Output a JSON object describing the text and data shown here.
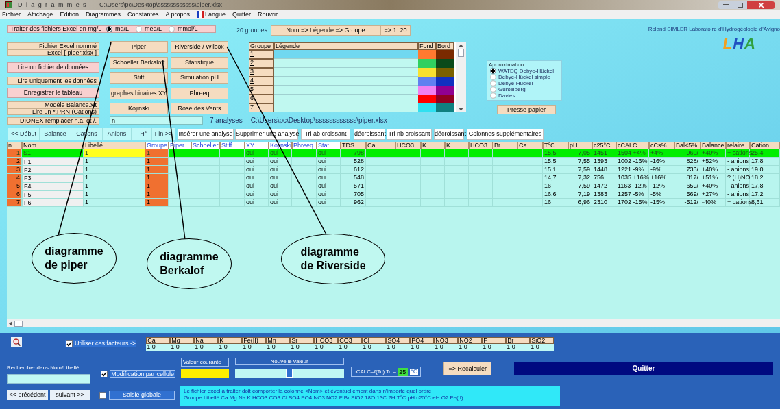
{
  "window": {
    "title": "Diagrammes",
    "path": "C:\\Users\\pc\\Desktop\\ssssssssssss\\piper.xlsx"
  },
  "menu": [
    {
      "label": "Fichier",
      "kind": "plain"
    },
    {
      "label": "Affichage",
      "kind": "plain"
    },
    {
      "label": "Edition",
      "kind": "plain"
    },
    {
      "label": "Diagrammes",
      "kind": "plain"
    },
    {
      "label": "Constantes",
      "kind": "plain"
    },
    {
      "label": "A propos",
      "kind": "plain"
    },
    {
      "label": "Langue",
      "kind": "flag"
    },
    {
      "label": "Quitter",
      "kind": "plain"
    },
    {
      "label": "Rouvrir",
      "kind": "plain"
    }
  ],
  "import": {
    "label": "Traiter des fichiers Excel en mg/L",
    "units": [
      {
        "label": "mg/L",
        "selected": true
      },
      {
        "label": "meq/L",
        "selected": false
      },
      {
        "label": "mmol/L",
        "selected": false
      }
    ]
  },
  "file_buttons": [
    {
      "label": "Fichier Excel nommé",
      "highlighted": false
    },
    {
      "label": "Excel [ piper.xlsx ]",
      "highlighted": false
    },
    {
      "label": "Lire un fichier de données",
      "highlighted": true
    },
    {
      "label": "Lire uniquement les données",
      "highlighted": false
    },
    {
      "label": "Enregistrer le tableau",
      "highlighted": true
    },
    {
      "label": "Modèle Balance.xlt",
      "highlighted": false
    },
    {
      "label": "Lire un *.PRN (Cations)",
      "highlighted": false
    }
  ],
  "dionex_button": "DIONEX remplacer n.a. et /.",
  "diagram_buttons": [
    "Piper",
    "Riverside / Wilcox",
    "Schoeller Berkaloff",
    "Statistique",
    "Stiff",
    "Simulation pH",
    "graphes binaires XY",
    "Phreeq",
    "Kojinski",
    "Rose des Vents"
  ],
  "filter_field": {
    "value": "n"
  },
  "analyses_count": "7 analyses",
  "file_path": "C:\\Users\\pc\\Desktop\\ssssssssssss\\piper.xlsx",
  "groups": {
    "count_label": "20 groupes",
    "buttons": [
      "Nom => Légende => Groupe",
      "=> 1..20"
    ],
    "columns": [
      "Groupe",
      "Légende",
      "Fond",
      "Bord"
    ],
    "rows": [
      {
        "group": "1",
        "selected": true,
        "swatches": [
          {
            "color": "#ff7a30"
          },
          {
            "color": "#7a2a00"
          }
        ]
      },
      {
        "group": "2",
        "selected": false,
        "swatches": [
          {
            "color": "#30d060"
          },
          {
            "color": "#0a4a1a"
          }
        ]
      },
      {
        "group": "3",
        "selected": false,
        "swatches": [
          {
            "color": "#f8e030"
          },
          {
            "color": "#7a6000"
          }
        ]
      },
      {
        "group": "4",
        "selected": false,
        "swatches": [
          {
            "color": "#6080f0"
          },
          {
            "color": "#1030c0"
          }
        ]
      },
      {
        "group": "5",
        "selected": false,
        "swatches": [
          {
            "color": "#f080f0"
          },
          {
            "color": "#900090"
          }
        ]
      },
      {
        "group": "6",
        "selected": false,
        "swatches": [
          {
            "color": "#ff0000"
          },
          {
            "color": "#900020"
          }
        ]
      },
      {
        "group": "7",
        "selected": false,
        "swatches": [
          {
            "color": "#30e0f0"
          },
          {
            "color": "#108080"
          }
        ]
      }
    ]
  },
  "approximation": {
    "title": "Approximation",
    "options": [
      {
        "label": "WATEQ Debye-Hückel",
        "selected": true
      },
      {
        "label": "Debye-Hückel simple",
        "selected": false
      },
      {
        "label": "Debye-Hückel",
        "selected": false
      },
      {
        "label": "Guntelberg",
        "selected": false
      },
      {
        "label": "Davies",
        "selected": false
      }
    ]
  },
  "clipboard_button": "Presse-papier",
  "credit": "Roland SIMLER Laboratoire d'Hydrogéologie d'Avigno",
  "logo": "LHA",
  "nav_buttons": [
    "<< Début",
    "Balance",
    "Cations",
    "Anions",
    "TH°",
    "Fin >>"
  ],
  "action_buttons": [
    "Insérer une analyse",
    "Supprimer une analyse",
    "Tri ab croissant",
    "décroissant",
    "Tri nb croissant",
    "décroissant",
    "Colonnes supplémentaires"
  ],
  "table": {
    "columns": [
      {
        "label": "n.",
        "diagram": false
      },
      {
        "label": "Nom",
        "diagram": false
      },
      {
        "label": "Libellé",
        "diagram": false
      },
      {
        "label": "Groupe",
        "diagram": true
      },
      {
        "label": "Piper",
        "diagram": true
      },
      {
        "label": "Schoeller",
        "diagram": true
      },
      {
        "label": "Stiff",
        "diagram": true
      },
      {
        "label": "XY",
        "diagram": true
      },
      {
        "label": "Kojinski",
        "diagram": true
      },
      {
        "label": "Phreeq",
        "diagram": true
      },
      {
        "label": "Stat",
        "diagram": true
      },
      {
        "label": "TDS",
        "diagram": false
      },
      {
        "label": "Ca",
        "diagram": false
      },
      {
        "label": "HCO3",
        "diagram": false
      },
      {
        "label": "K",
        "diagram": false
      },
      {
        "label": "K",
        "diagram": false
      },
      {
        "label": "HCO3",
        "diagram": false
      },
      {
        "label": "Br",
        "diagram": false
      },
      {
        "label": "Ca",
        "diagram": false
      },
      {
        "label": "T°C",
        "diagram": false
      },
      {
        "label": "pH",
        "diagram": false
      },
      {
        "label": "c25°C",
        "diagram": false
      },
      {
        "label": "cCALC",
        "diagram": false
      },
      {
        "label": "cCs%",
        "diagram": false
      },
      {
        "label": "Bal<5%",
        "diagram": false
      },
      {
        "label": "Balance",
        "diagram": false
      },
      {
        "label": "relaire",
        "diagram": false
      },
      {
        "label": "Cation",
        "diagram": false
      }
    ],
    "rows": [
      {
        "selected": true,
        "cells": [
          "1",
          "S1",
          "1",
          "1",
          null,
          null,
          null,
          "oui",
          "oui",
          null,
          "oui",
          "798",
          null,
          null,
          null,
          null,
          null,
          null,
          null,
          "15,5",
          "7,05",
          "1451",
          "1504 +4%",
          "+4%",
          "960/",
          "+40%",
          "+ cations",
          "25,4"
        ]
      },
      {
        "selected": false,
        "cells": [
          "2",
          "F1",
          "1",
          "1",
          null,
          null,
          null,
          "oui",
          "oui",
          null,
          "oui",
          "528",
          null,
          null,
          null,
          null,
          null,
          null,
          null,
          "15,5",
          "7,55",
          "1393",
          "1002 -16%",
          "-16%",
          "828/",
          "+52%",
          "- anions",
          "17,8"
        ]
      },
      {
        "selected": false,
        "cells": [
          "3",
          "F2",
          "1",
          "1",
          null,
          null,
          null,
          "oui",
          "oui",
          null,
          "oui",
          "612",
          null,
          null,
          null,
          null,
          null,
          null,
          null,
          "15,1",
          "7,59",
          "1448",
          "1221 -9%",
          "-9%",
          "733/",
          "+40%",
          "- anions",
          "19,0"
        ]
      },
      {
        "selected": false,
        "cells": [
          "4",
          "F3",
          "1",
          "1",
          null,
          null,
          null,
          "oui",
          "oui",
          null,
          "oui",
          "548",
          null,
          null,
          null,
          null,
          null,
          null,
          null,
          "14,7",
          "7,32",
          "756",
          "1035 +16%",
          "+16%",
          "817/",
          "+51%",
          "? (H)NO",
          "18,2"
        ]
      },
      {
        "selected": false,
        "cells": [
          "5",
          "F4",
          "1",
          "1",
          null,
          null,
          null,
          "oui",
          "oui",
          null,
          "oui",
          "571",
          null,
          null,
          null,
          null,
          null,
          null,
          null,
          "16",
          "7,59",
          "1472",
          "1163 -12%",
          "-12%",
          "659/",
          "+40%",
          "- anions",
          "17,8"
        ]
      },
      {
        "selected": false,
        "cells": [
          "6",
          "F5",
          "1",
          "1",
          null,
          null,
          null,
          "oui",
          "oui",
          null,
          "oui",
          "705",
          null,
          null,
          null,
          null,
          null,
          null,
          null,
          "16,6",
          "7,19",
          "1383",
          "1257 -5%",
          "-5%",
          "569/",
          "+27%",
          "- anions",
          "17,2"
        ]
      },
      {
        "selected": false,
        "cells": [
          "7",
          "F6",
          "1",
          "1",
          null,
          null,
          null,
          "oui",
          "oui",
          null,
          "oui",
          "962",
          null,
          null,
          null,
          null,
          null,
          null,
          null,
          "16",
          "6,96",
          "2310",
          "1702 -15%",
          "-15%",
          "-512/",
          "-40%",
          "+ cations",
          "8,61"
        ]
      }
    ]
  },
  "annotations": [
    {
      "lines": [
        "diagramme",
        "de piper"
      ]
    },
    {
      "lines": [
        "diagramme",
        "Berkalof"
      ]
    },
    {
      "lines": [
        "diagramme",
        "de Riverside"
      ]
    }
  ],
  "factors": {
    "label": "Utiliser ces facteurs ->",
    "checked": true,
    "items": [
      {
        "name": "Ca",
        "value": "1.0"
      },
      {
        "name": "Mg",
        "value": "1.0"
      },
      {
        "name": "Na",
        "value": "1.0"
      },
      {
        "name": "K",
        "value": "1.0"
      },
      {
        "name": "Fe(II)",
        "value": "1.0"
      },
      {
        "name": "Mn",
        "value": "1.0"
      },
      {
        "name": "Sr",
        "value": "1.0"
      },
      {
        "name": "HCO3",
        "value": "1.0"
      },
      {
        "name": "CO3",
        "value": "1.0"
      },
      {
        "name": "Cl",
        "value": "1.0"
      },
      {
        "name": "SO4",
        "value": "1.0"
      },
      {
        "name": "PO4",
        "value": "1.0"
      },
      {
        "name": "NO3",
        "value": "1.0"
      },
      {
        "name": "NO2",
        "value": "1.0"
      },
      {
        "name": "F",
        "value": "1.0"
      },
      {
        "name": "Br",
        "value": "1.0"
      },
      {
        "name": "SiO2",
        "value": "1.0"
      }
    ]
  },
  "search": {
    "label": "Rechercher dans Nom/Libellé"
  },
  "cell_edit": {
    "label": "Modification par cellule",
    "checked": true
  },
  "global_edit": {
    "label": "Saisie globale",
    "checked": false
  },
  "current_value": {
    "label": "Valeur courante"
  },
  "new_value": {
    "label": "Nouvelle valeur"
  },
  "recalc": {
    "label": "cCALC=f(Tc) Tc =",
    "value": "25",
    "unit": "°C",
    "button": "=> Recalculer"
  },
  "quit_button": "Quitter",
  "prev_button": "<< précédent",
  "next_button": "suivant >>",
  "info": [
    "Le fichier excel à traiter doit comporter la colonne <Nom> et éventuellement dans n'importe quel ordre",
    "Groupe Libellé Ca Mg Na K HCO3 CO3 Cl SO4 PO4 NO3 NO2 F Br SiO2 18O 13C 2H T°C pH c25°C eH O2 Fe(II)"
  ]
}
